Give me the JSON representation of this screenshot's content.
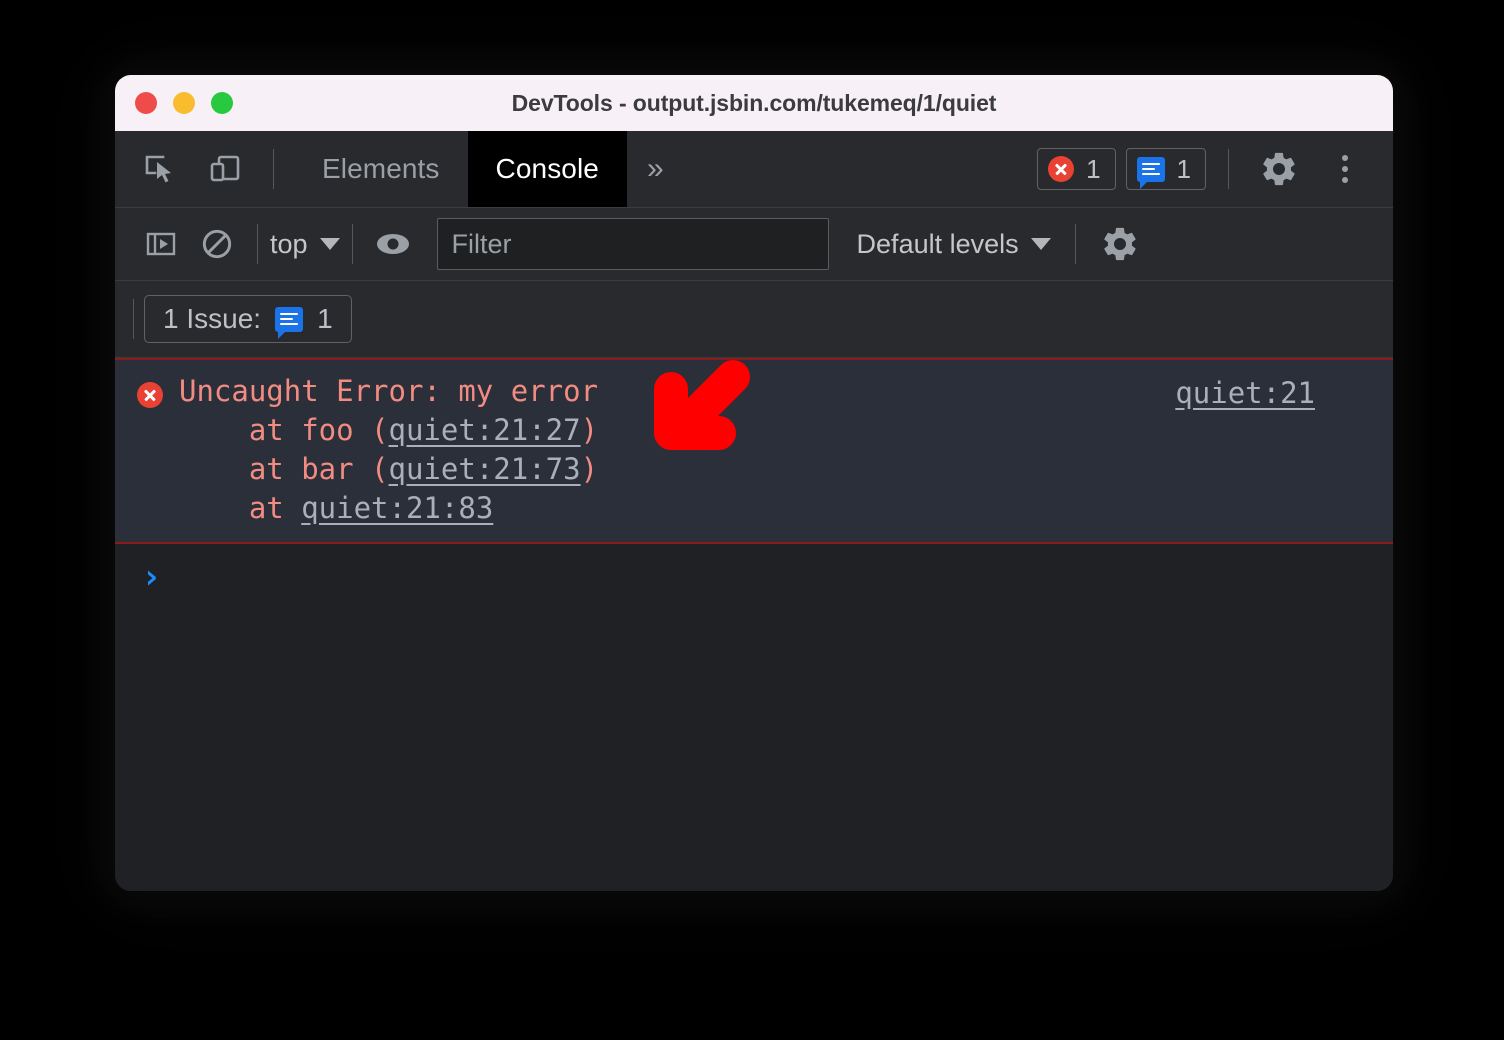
{
  "window": {
    "title": "DevTools - output.jsbin.com/tukemeq/1/quiet",
    "traffic_lights": [
      "close",
      "minimize",
      "zoom"
    ],
    "colors": {
      "titlebar_bg": "#f7f1f7",
      "panel_bg": "#292a2d",
      "console_bg": "#202124",
      "error_bg": "#2a2f3a",
      "error_border": "#8b1a1a",
      "error_text": "#f28b82",
      "link_text": "#a8b0bb",
      "accent_blue": "#1a73e8",
      "annotation_red": "#ff0000"
    }
  },
  "tabbar": {
    "inspect_icon": "inspect-element-icon",
    "device_icon": "device-toolbar-icon",
    "tabs": [
      {
        "label": "Elements",
        "active": false
      },
      {
        "label": "Console",
        "active": true
      }
    ],
    "more_tabs_label": "»",
    "error_count": "1",
    "issue_count": "1",
    "settings_icon": "gear-icon",
    "menu_icon": "more-vertical-icon"
  },
  "console_toolbar": {
    "sidebar_toggle_icon": "console-sidebar-icon",
    "clear_icon": "clear-console-icon",
    "context_label": "top",
    "eye_icon": "live-expression-icon",
    "filter_placeholder": "Filter",
    "filter_value": "",
    "levels_label": "Default levels",
    "settings_icon": "gear-icon"
  },
  "issues_bar": {
    "chip_label": "1 Issue:",
    "chip_icon": "issue-bubble-icon",
    "chip_count": "1"
  },
  "console_output": {
    "message": {
      "level": "error",
      "icon": "error-circle-icon",
      "header": "Uncaught Error: my error",
      "source_link": "quiet:21",
      "stack": [
        {
          "prefix": "    at foo (",
          "link": "quiet:21:27",
          "suffix": ")"
        },
        {
          "prefix": "    at bar (",
          "link": "quiet:21:73",
          "suffix": ")"
        },
        {
          "prefix": "    at ",
          "link": "quiet:21:83",
          "suffix": ""
        }
      ]
    },
    "prompt_caret": "›"
  },
  "annotation": {
    "type": "arrow",
    "direction": "down-left",
    "color": "#ff0000"
  }
}
